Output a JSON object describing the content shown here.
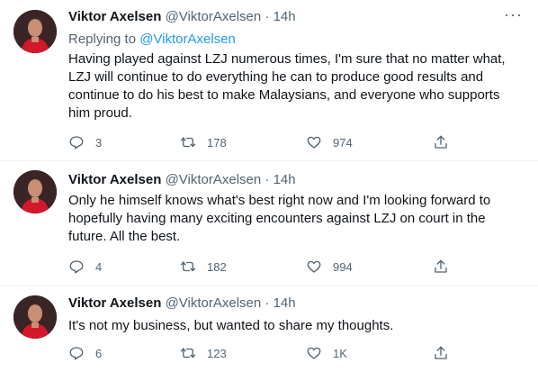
{
  "tweets": [
    {
      "name": "Viktor Axelsen",
      "handle": "@ViktorAxelsen",
      "dot": "·",
      "time": "14h",
      "more": "···",
      "replying_label": "Replying to",
      "replying_to": "@ViktorAxelsen",
      "text": "Having played against LZJ numerous times, I'm sure that no matter what, LZJ will continue to do everything he can to produce good results and continue to do his best to make Malaysians, and everyone who supports him proud.",
      "replies": "3",
      "retweets": "178",
      "likes": "974"
    },
    {
      "name": "Viktor Axelsen",
      "handle": "@ViktorAxelsen",
      "dot": "·",
      "time": "14h",
      "text": "Only he himself knows what's best right now and I'm looking forward to hopefully having many exciting encounters against LZJ on court in the future.  All the best.",
      "replies": "4",
      "retweets": "182",
      "likes": "994"
    },
    {
      "name": "Viktor Axelsen",
      "handle": "@ViktorAxelsen",
      "dot": "·",
      "time": "14h",
      "text": "It's not my business, but wanted to share my thoughts.",
      "replies": "6",
      "retweets": "123",
      "likes": "1K"
    }
  ],
  "colors": {
    "text": "#0f1419",
    "secondary": "#536471",
    "link": "#1d9bf0",
    "divider": "#eff3f4"
  },
  "icons": [
    "reply-icon",
    "retweet-icon",
    "like-icon",
    "share-icon",
    "more-icon"
  ]
}
